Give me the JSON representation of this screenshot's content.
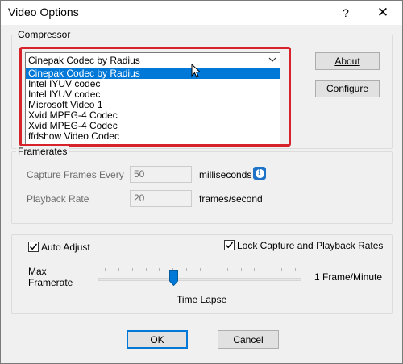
{
  "window": {
    "title": "Video Options",
    "help_symbol": "?",
    "close_symbol": "✕"
  },
  "compressor": {
    "group_label": "Compressor",
    "selected": "Cinepak Codec by Radius",
    "options": [
      "Cinepak Codec by Radius",
      "Intel IYUV codec",
      "Intel IYUV codec",
      "Microsoft Video 1",
      "Xvid MPEG-4 Codec",
      "Xvid MPEG-4 Codec",
      "ffdshow Video Codec"
    ],
    "selected_index": 0,
    "about_label": "About",
    "configure_label": "Configure"
  },
  "framerates": {
    "group_label": "Framerates",
    "capture_label": "Capture Frames Every",
    "capture_value": "50",
    "capture_unit": "milliseconds",
    "playback_label": "Playback Rate",
    "playback_value": "20",
    "playback_unit": "frames/second"
  },
  "timelapse": {
    "auto_adjust_label": "Auto Adjust",
    "auto_adjust_checked": true,
    "lock_label": "Lock Capture and Playback Rates",
    "lock_checked": true,
    "max_label_line1": "Max",
    "max_label_line2": "Framerate",
    "min_label": "1 Frame/Minute",
    "slider_caption": "Time Lapse",
    "slider_level": 0.37
  },
  "footer": {
    "ok_label": "OK",
    "cancel_label": "Cancel"
  },
  "colors": {
    "highlight": "#d6222a",
    "selection": "#0078d7",
    "info": "#1e72c8"
  }
}
